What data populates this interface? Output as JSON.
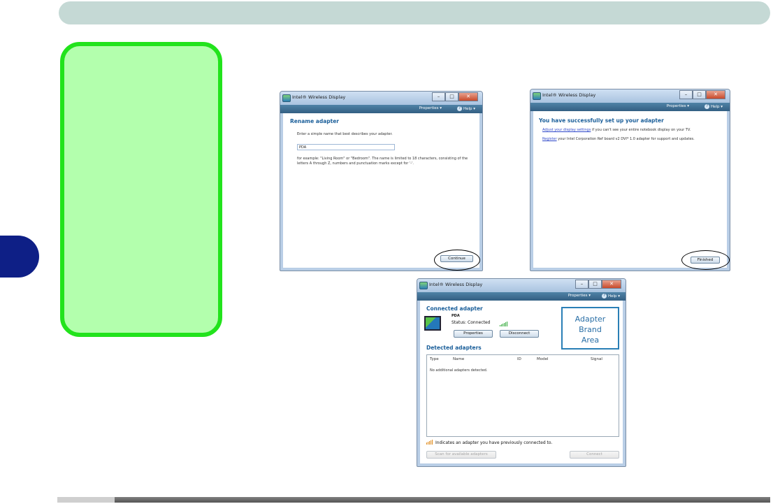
{
  "window_title": "Intel® Wireless Display",
  "menu": {
    "properties": "Properties",
    "help": "Help"
  },
  "win1": {
    "heading": "Rename adapter",
    "instruction": "Enter a simple name that best describes your adapter.",
    "name_value": "PDA",
    "note": "for example: \"Living Room\" or \"Bedroom\". The name is limited to 18 characters, consisting of the letters A through Z, numbers and punctuation marks except for '-'.",
    "continue_button": "Continue"
  },
  "win2": {
    "heading": "You have successfully set up your adapter",
    "line1_link": "Adjust your display settings",
    "line1_rest": " if you can't see your entire notebook display on your TV.",
    "line2_link": "Register",
    "line2_rest": " your Intel Corporation Ref board v2 DVI* 1.0 adapter for support and updates.",
    "finished_button": "Finished"
  },
  "win3": {
    "connected_heading": "Connected adapter",
    "adapter_name": "PDA",
    "status": "Status: Connected",
    "properties_button": "Properties",
    "disconnect_button": "Disconnect",
    "brand_area": [
      "Adapter",
      "Brand",
      "Area"
    ],
    "detected_heading": "Detected adapters",
    "columns": [
      "Type",
      "Name",
      "ID",
      "Model",
      "Signal"
    ],
    "empty_text": "No additional adapters detected.",
    "footnote": "Indicates an adapter you have previously connected to.",
    "scan_button": "Scan for available adapters",
    "connect_button": "Connect"
  }
}
